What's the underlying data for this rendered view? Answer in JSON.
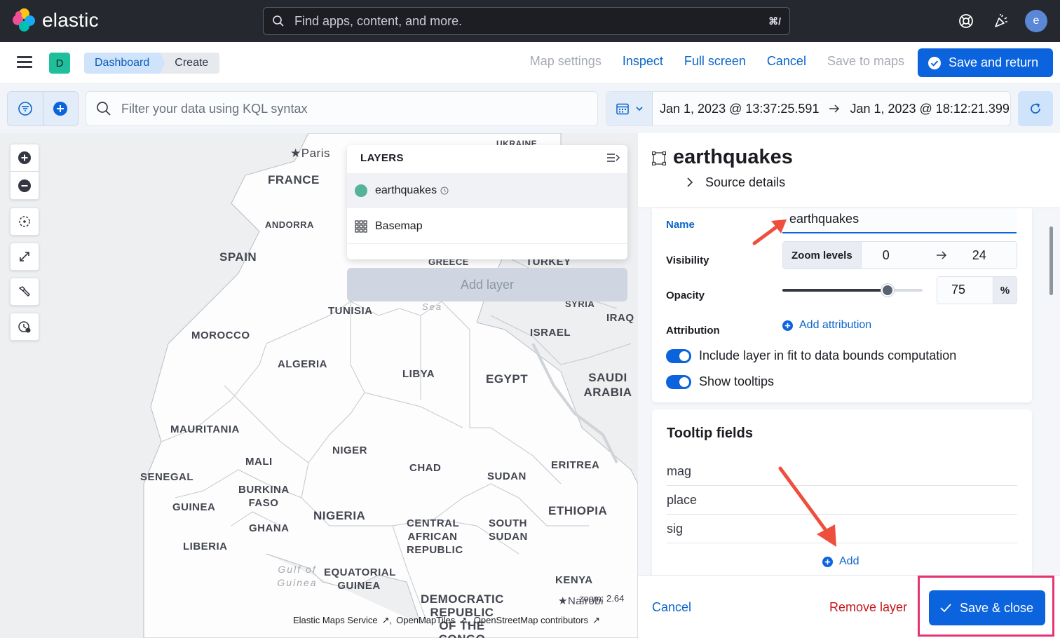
{
  "app": {
    "brand": "elastic",
    "search_placeholder": "Find apps, content, and more.",
    "search_shortcut": "⌘/",
    "avatar_initial": "e"
  },
  "nav": {
    "space_initial": "D",
    "breadcrumbs": [
      "Dashboard",
      "Create"
    ],
    "links": [
      {
        "label": "Map settings",
        "enabled": false
      },
      {
        "label": "Inspect",
        "enabled": true
      },
      {
        "label": "Full screen",
        "enabled": true
      },
      {
        "label": "Cancel",
        "enabled": true
      },
      {
        "label": "Save to maps",
        "enabled": false
      }
    ],
    "primary_action": "Save and return"
  },
  "query": {
    "placeholder": "Filter your data using KQL syntax",
    "start": "Jan 1, 2023 @ 13:37:25.591",
    "end": "Jan 1, 2023 @ 18:12:21.399"
  },
  "map": {
    "labels": {
      "paris": "Paris",
      "france": "FRANCE",
      "andorra": "ANDORRA",
      "spain": "SPAIN",
      "tunisia": "TUNISIA",
      "morocco": "MOROCCO",
      "algeria": "ALGERIA",
      "libya": "LIBYA",
      "egypt": "EGYPT",
      "saudi": "SAUDI ARABIA",
      "israel": "ISRAEL",
      "iraq": "IRAQ",
      "syria": "SYRIA",
      "mauritania": "MAURITANIA",
      "mali": "MALI",
      "niger": "NIGER",
      "chad": "CHAD",
      "sudan": "SUDAN",
      "eritrea": "ERITREA",
      "senegal": "SENEGAL",
      "burkina": "BURKINA FASO",
      "guinea": "GUINEA",
      "nigeria": "NIGERIA",
      "ghana": "GHANA",
      "liberia": "LIBERIA",
      "car": "CENTRAL AFRICAN REPUBLIC",
      "south_sudan": "SOUTH SUDAN",
      "ethiopia": "ETHIOPIA",
      "eq_guinea": "EQUATORIAL GUINEA",
      "kenya": "KENYA",
      "nairobi": "Nairobi",
      "drc": "DEMOCRATIC REPUBLIC OF THE CONGO",
      "greece": "GREECE",
      "turkey": "TURKEY",
      "ukraine": "UKRAINE",
      "gulf": "Gulf of Guinea",
      "sea": "Sea"
    },
    "layers_title": "LAYERS",
    "layers": [
      {
        "name": "earthquakes",
        "color": "#54b399"
      },
      {
        "name": "Basemap"
      }
    ],
    "add_layer": "Add layer",
    "attribution": [
      "Elastic Maps Service",
      "OpenMapTiles",
      "OpenStreetMap contributors"
    ],
    "zoom_label": "zoom: 2.64"
  },
  "panel": {
    "title": "earthquakes",
    "source_details": "Source details",
    "name_label": "Name",
    "name_value": "earthquakes",
    "visibility_label": "Visibility",
    "zoom_levels_label": "Zoom levels",
    "zoom_min": "0",
    "zoom_max": "24",
    "opacity_label": "Opacity",
    "opacity_value": "75",
    "opacity_unit": "%",
    "attribution_label": "Attribution",
    "add_attribution": "Add attribution",
    "fit_bounds_label": "Include layer in fit to data bounds computation",
    "fit_bounds_on": true,
    "show_tooltips_label": "Show tooltips",
    "show_tooltips_on": true,
    "tooltip_title": "Tooltip fields",
    "tooltip_fields": [
      "mag",
      "place",
      "sig"
    ],
    "tooltip_add": "Add",
    "footer_cancel": "Cancel",
    "footer_remove": "Remove layer",
    "footer_save": "Save & close"
  },
  "colors": {
    "primary": "#0b64dd",
    "header_bg": "#25282f",
    "danger": "#c4161c",
    "highlight": "#e63473",
    "annotation_arrow": "#ee4f3d"
  }
}
